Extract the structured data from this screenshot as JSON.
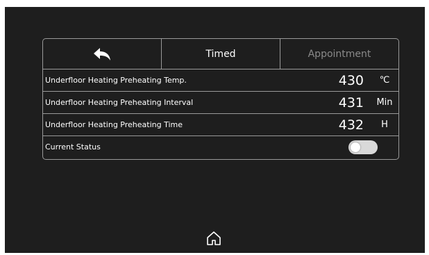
{
  "tabs": {
    "back_icon": "back-arrow-icon",
    "timed_label": "Timed",
    "appointment_label": "Appointment"
  },
  "rows": [
    {
      "label": "Underfloor Heating Preheating Temp.",
      "value": "430",
      "unit": "℃"
    },
    {
      "label": "Underfloor Heating Preheating Interval",
      "value": "431",
      "unit": "Min"
    },
    {
      "label": "Underfloor Heating Preheating Time",
      "value": "432",
      "unit": "H"
    }
  ],
  "status": {
    "label": "Current Status",
    "toggle_on": false
  },
  "footer": {
    "home_icon": "home-icon"
  }
}
